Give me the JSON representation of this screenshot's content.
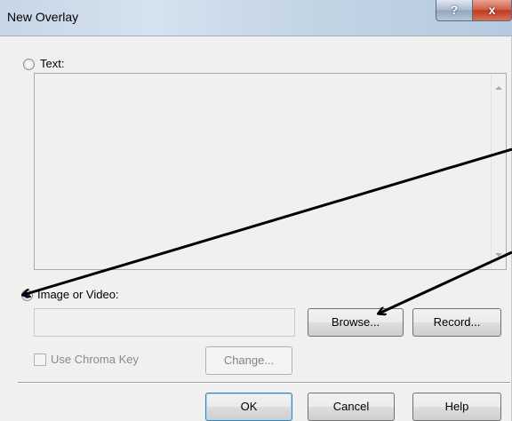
{
  "window": {
    "title": "New Overlay",
    "help_label": "?",
    "close_label": "x"
  },
  "text_option": {
    "label": "Text:",
    "selected": false,
    "value": ""
  },
  "image_option": {
    "label": "Image or Video:",
    "selected": true,
    "path_value": "",
    "browse_label": "Browse...",
    "record_label": "Record..."
  },
  "chroma": {
    "label": "Use Chroma Key",
    "checked": false,
    "change_label": "Change..."
  },
  "footer": {
    "ok_label": "OK",
    "cancel_label": "Cancel",
    "help_label": "Help"
  },
  "annotation_color": "#000000"
}
